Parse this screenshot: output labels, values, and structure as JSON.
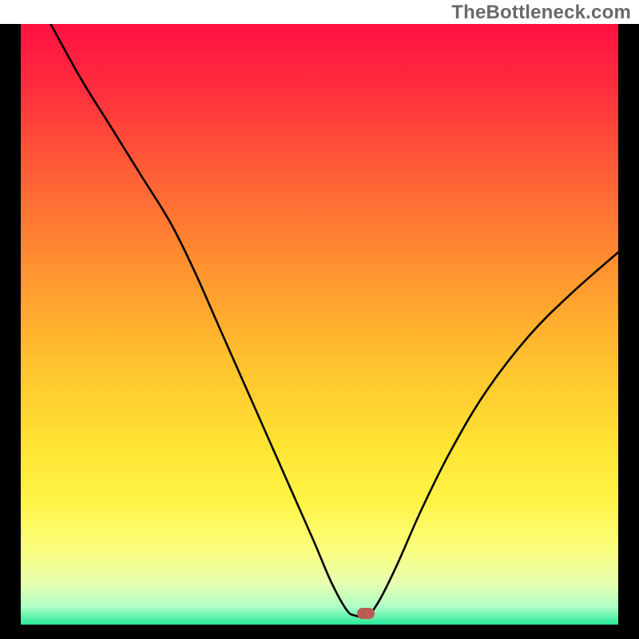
{
  "watermark": "TheBottleneck.com",
  "plot": {
    "inner_left": 26,
    "inner_top": 30,
    "inner_width": 748,
    "inner_height": 752,
    "gradient_stops": [
      {
        "offset": 0.0,
        "color": "#ff1142"
      },
      {
        "offset": 0.1,
        "color": "#ff2b3e"
      },
      {
        "offset": 0.25,
        "color": "#ff5f36"
      },
      {
        "offset": 0.4,
        "color": "#ff9030"
      },
      {
        "offset": 0.55,
        "color": "#ffbe2e"
      },
      {
        "offset": 0.7,
        "color": "#ffe333"
      },
      {
        "offset": 0.8,
        "color": "#fff548"
      },
      {
        "offset": 0.88,
        "color": "#faff83"
      },
      {
        "offset": 0.93,
        "color": "#e8ffb0"
      },
      {
        "offset": 0.97,
        "color": "#b0ffc6"
      },
      {
        "offset": 1.0,
        "color": "#27e999"
      }
    ],
    "curve_color": "#000000",
    "curve_width": 2.6,
    "marker": {
      "x_frac": 0.577,
      "y_frac": 0.982,
      "color": "#bb5c54"
    }
  },
  "chart_data": {
    "type": "line",
    "title": "",
    "xlabel": "",
    "ylabel": "",
    "xlim": [
      0,
      100
    ],
    "ylim": [
      0,
      100
    ],
    "x": [
      5,
      10,
      15,
      20,
      25,
      29,
      33,
      37,
      41,
      45,
      49,
      52,
      54.5,
      56,
      58,
      60,
      63,
      67,
      72,
      78,
      85,
      92,
      100
    ],
    "values": [
      100,
      91,
      83,
      75,
      67,
      59,
      50,
      41,
      32,
      23,
      14,
      7,
      2.5,
      1.5,
      1.5,
      4,
      10,
      19,
      29,
      39,
      48,
      55,
      62
    ],
    "series": [
      {
        "name": "bottleneck-curve",
        "x": [
          5,
          10,
          15,
          20,
          25,
          29,
          33,
          37,
          41,
          45,
          49,
          52,
          54.5,
          56,
          58,
          60,
          63,
          67,
          72,
          78,
          85,
          92,
          100
        ],
        "values": [
          100,
          91,
          83,
          75,
          67,
          59,
          50,
          41,
          32,
          23,
          14,
          7,
          2.5,
          1.5,
          1.5,
          4,
          10,
          19,
          29,
          39,
          48,
          55,
          62
        ]
      }
    ],
    "annotations": [
      {
        "type": "marker",
        "x": 57.7,
        "y": 1.8,
        "label": "optimal-point"
      }
    ]
  }
}
